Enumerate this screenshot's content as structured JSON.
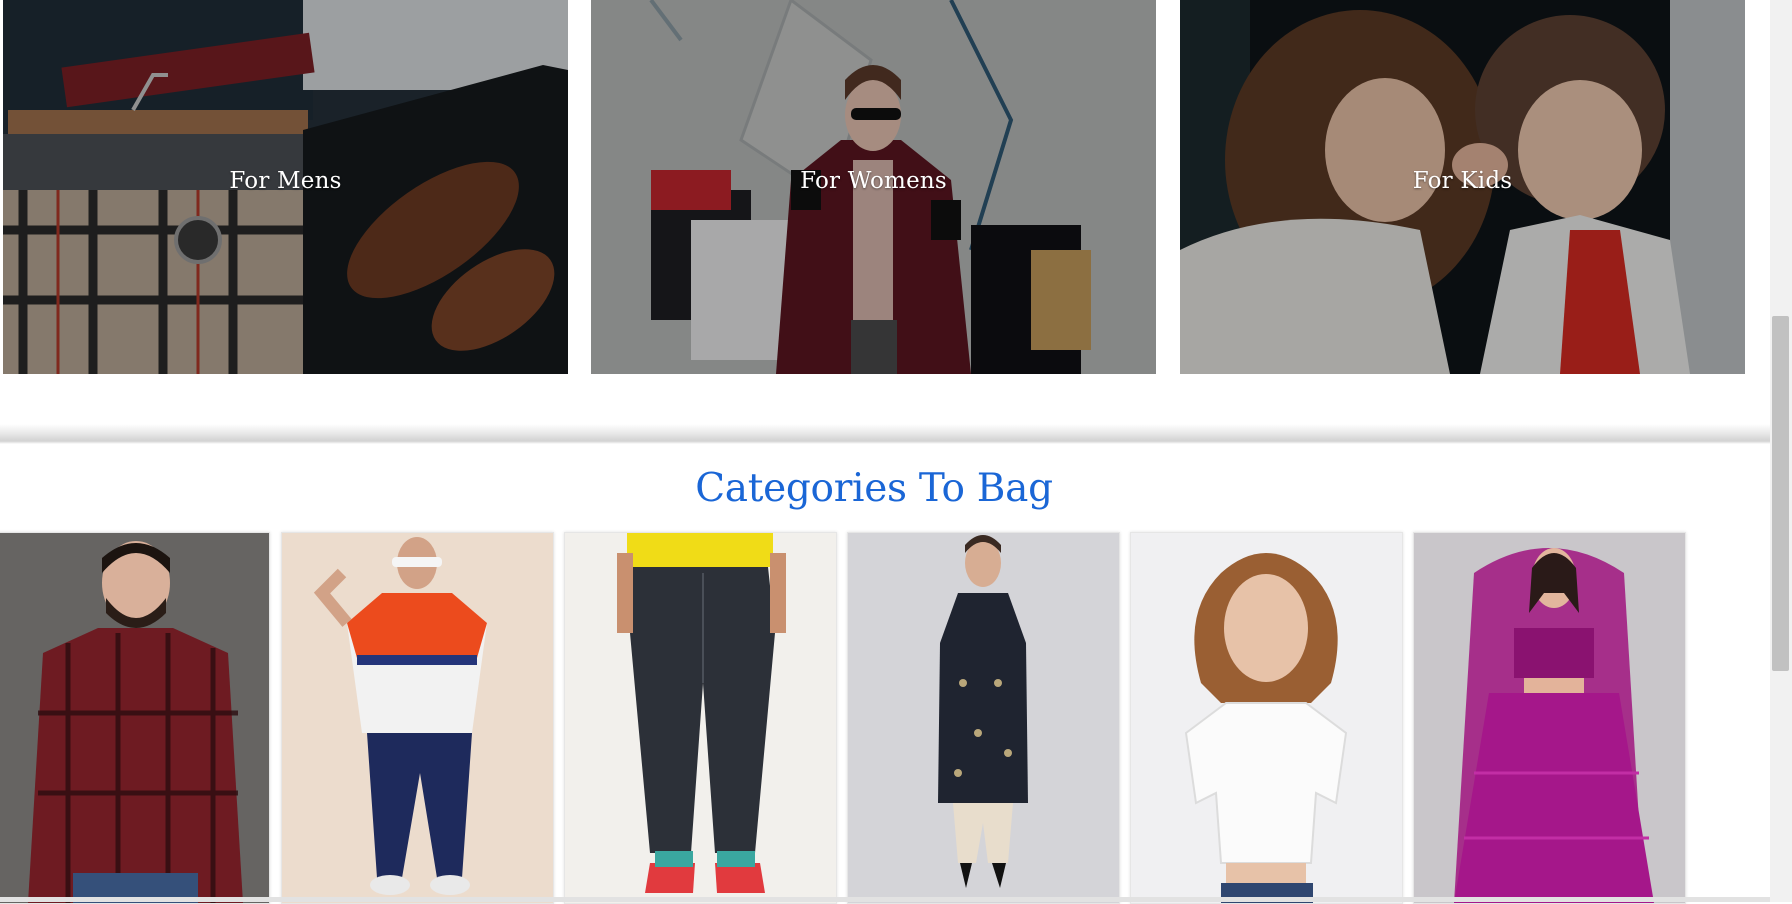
{
  "banners": [
    {
      "label": "For Mens",
      "image": "mens-fashion-photo"
    },
    {
      "label": "For Womens",
      "image": "womens-shopping-photo"
    },
    {
      "label": "For Kids",
      "image": "kids-whispering-photo"
    }
  ],
  "categories_section": {
    "title": "Categories To Bag",
    "items": [
      {
        "image": "man-red-check-shirt"
      },
      {
        "image": "man-tshirt-joggers"
      },
      {
        "image": "jeans-red-sneakers"
      },
      {
        "image": "woman-kurta-set"
      },
      {
        "image": "woman-white-top"
      },
      {
        "image": "woman-purple-lehenga"
      }
    ]
  },
  "colors": {
    "accent": "#1a66d6"
  }
}
